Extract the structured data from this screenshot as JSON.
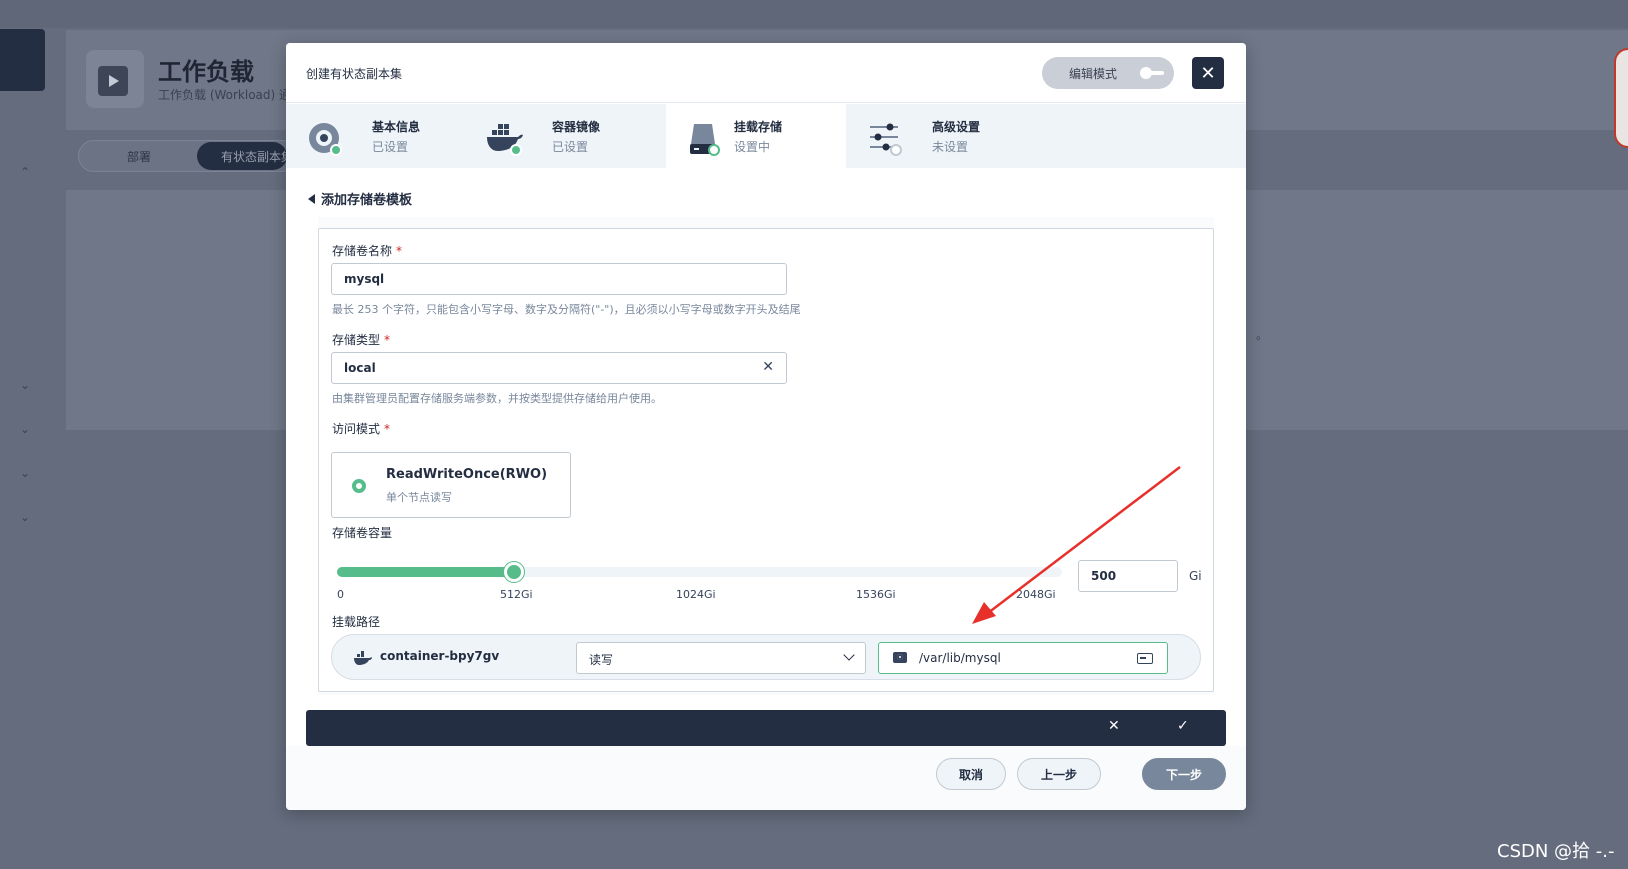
{
  "background": {
    "page_title": "工作负载",
    "page_subtitle": "工作负载 (Workload) 通",
    "tabs": [
      "部署",
      "有状态副本集"
    ]
  },
  "modal": {
    "title": "创建有状态副本集",
    "edit_mode_label": "编辑模式",
    "close_icon": "close-icon",
    "steps": [
      {
        "name": "基本信息",
        "state": "已设置",
        "icon": "gear-disk-icon"
      },
      {
        "name": "容器镜像",
        "state": "已设置",
        "icon": "docker-icon"
      },
      {
        "name": "挂载存储",
        "state": "设置中",
        "icon": "storage-disk-icon"
      },
      {
        "name": "高级设置",
        "state": "未设置",
        "icon": "sliders-icon"
      }
    ],
    "section_title": "添加存储卷模板",
    "form": {
      "volume_name_label": "存储卷名称",
      "required_mark": "*",
      "volume_name_value": "mysql",
      "volume_name_hint": "最长 253 个字符，只能包含小写字母、数字及分隔符(\"-\")，且必须以小写字母或数字开头及结尾",
      "storage_type_label": "存储类型",
      "storage_type_value": "local",
      "storage_type_hint": "由集群管理员配置存储服务端参数，并按类型提供存储给用户使用。",
      "access_mode_label": "访问模式",
      "access_mode_title": "ReadWriteOnce(RWO)",
      "access_mode_desc": "单个节点读写",
      "capacity_label": "存储卷容量",
      "capacity_value": "500",
      "capacity_unit": "Gi",
      "capacity_max_gi": 2048,
      "capacity_fraction": 0.244,
      "slider_ticks": [
        "0",
        "512Gi",
        "1024Gi",
        "1536Gi",
        "2048Gi"
      ],
      "mount_path_label": "挂载路径",
      "container_name": "container-bpy7gv",
      "mount_mode": "读写",
      "mount_path": "/var/lib/mysql"
    },
    "footer": {
      "cancel": "取消",
      "prev": "上一步",
      "next": "下一步"
    }
  },
  "watermark": "CSDN @拾 -.-",
  "colors": {
    "accent_green": "#55bc8a",
    "dark": "#242e42",
    "annotation_arrow": "#e8302b"
  }
}
